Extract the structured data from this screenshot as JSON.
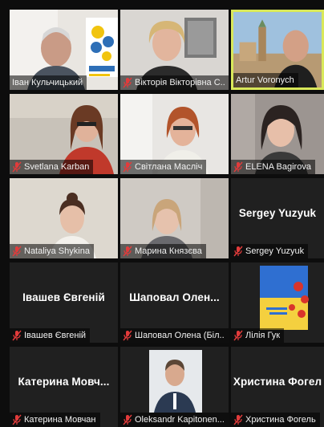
{
  "participants": [
    {
      "name": "Іван Кульчицький",
      "muted": false,
      "speaking": false,
      "video": "man-logo"
    },
    {
      "name": "Вікторія Вікторівна С...",
      "muted": true,
      "speaking": false,
      "video": "woman-blonde"
    },
    {
      "name": "Artur Voronych",
      "muted": false,
      "speaking": true,
      "video": "man-city"
    },
    {
      "name": "Svetlana Karban",
      "muted": true,
      "speaking": false,
      "video": "woman-glasses"
    },
    {
      "name": "Світлана Масліч",
      "muted": true,
      "speaking": false,
      "video": "woman-redhead"
    },
    {
      "name": "ELENA Bagirova",
      "muted": true,
      "speaking": false,
      "video": "woman-dark"
    },
    {
      "name": "Nataliya Shykina",
      "muted": true,
      "speaking": false,
      "video": "woman-bun"
    },
    {
      "name": "Марина Князєва",
      "muted": true,
      "speaking": false,
      "video": "woman-light"
    },
    {
      "name": "Sergey Yuzyuk",
      "muted": true,
      "speaking": false,
      "video": "none",
      "center": "Sergey Yuzyuk"
    },
    {
      "name": "Івашев Євгеній",
      "muted": true,
      "speaking": false,
      "video": "none",
      "center": "Івашев Євгеній"
    },
    {
      "name": "Шаповал Олена (Біл...",
      "muted": true,
      "speaking": false,
      "video": "none",
      "center": "Шаповал Олен..."
    },
    {
      "name": "Лілія Гук",
      "muted": true,
      "speaking": false,
      "video": "flag-photo"
    },
    {
      "name": "Катерина Мовчан",
      "muted": true,
      "speaking": false,
      "video": "none",
      "center": "Катерина Мовч..."
    },
    {
      "name": "Oleksandr Kapitonen...",
      "muted": true,
      "speaking": false,
      "video": "man-photo"
    },
    {
      "name": "Христина Фогель",
      "muted": true,
      "speaking": false,
      "video": "none",
      "center": "Христина Фогел"
    }
  ],
  "colors": {
    "tile_bg": "#202020",
    "speaking_border": "#d9e85a",
    "muted_mic": "#e23b3b",
    "text": "#ffffff"
  }
}
